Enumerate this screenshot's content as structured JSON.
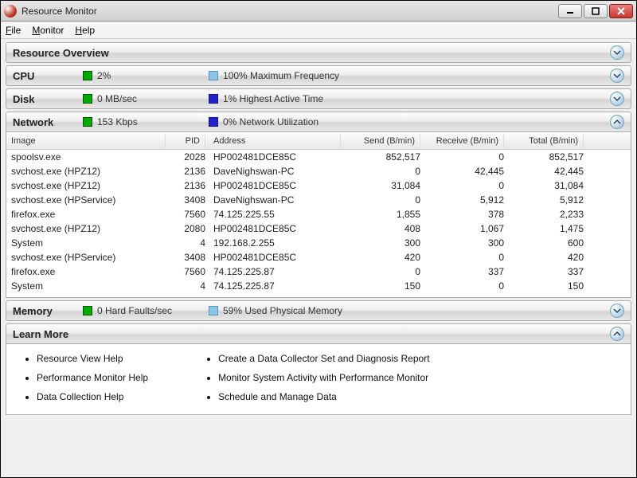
{
  "window": {
    "title": "Resource Monitor"
  },
  "menu": {
    "file": "File",
    "monitor": "Monitor",
    "help": "Help"
  },
  "panels": {
    "overview": {
      "label": "Resource Overview"
    },
    "cpu": {
      "label": "CPU",
      "metric1": "2%",
      "metric2": "100% Maximum Frequency"
    },
    "disk": {
      "label": "Disk",
      "metric1": "0 MB/sec",
      "metric2": "1% Highest Active Time"
    },
    "network": {
      "label": "Network",
      "metric1": "153 Kbps",
      "metric2": "0% Network Utilization"
    },
    "memory": {
      "label": "Memory",
      "metric1": "0 Hard Faults/sec",
      "metric2": "59% Used Physical Memory"
    },
    "learn": {
      "label": "Learn More"
    }
  },
  "network_table": {
    "headers": {
      "image": "Image",
      "pid": "PID",
      "address": "Address",
      "send": "Send (B/min)",
      "receive": "Receive (B/min)",
      "total": "Total (B/min)"
    },
    "rows": [
      {
        "image": "spoolsv.exe",
        "pid": "2028",
        "address": "HP002481DCE85C",
        "send": "852,517",
        "receive": "0",
        "total": "852,517"
      },
      {
        "image": "svchost.exe (HPZ12)",
        "pid": "2136",
        "address": "DaveNighswan-PC",
        "send": "0",
        "receive": "42,445",
        "total": "42,445"
      },
      {
        "image": "svchost.exe (HPZ12)",
        "pid": "2136",
        "address": "HP002481DCE85C",
        "send": "31,084",
        "receive": "0",
        "total": "31,084"
      },
      {
        "image": "svchost.exe (HPService)",
        "pid": "3408",
        "address": "DaveNighswan-PC",
        "send": "0",
        "receive": "5,912",
        "total": "5,912"
      },
      {
        "image": "firefox.exe",
        "pid": "7560",
        "address": "74.125.225.55",
        "send": "1,855",
        "receive": "378",
        "total": "2,233"
      },
      {
        "image": "svchost.exe (HPZ12)",
        "pid": "2080",
        "address": "HP002481DCE85C",
        "send": "408",
        "receive": "1,067",
        "total": "1,475"
      },
      {
        "image": "System",
        "pid": "4",
        "address": "192.168.2.255",
        "send": "300",
        "receive": "300",
        "total": "600"
      },
      {
        "image": "svchost.exe (HPService)",
        "pid": "3408",
        "address": "HP002481DCE85C",
        "send": "420",
        "receive": "0",
        "total": "420"
      },
      {
        "image": "firefox.exe",
        "pid": "7560",
        "address": "74.125.225.87",
        "send": "0",
        "receive": "337",
        "total": "337"
      },
      {
        "image": "System",
        "pid": "4",
        "address": "74.125.225.87",
        "send": "150",
        "receive": "0",
        "total": "150"
      }
    ]
  },
  "learn_more": {
    "col1": [
      "Resource View Help",
      "Performance Monitor Help",
      "Data Collection Help"
    ],
    "col2": [
      "Create a Data Collector Set and Diagnosis Report",
      "Monitor System Activity with Performance Monitor",
      "Schedule and Manage Data"
    ]
  }
}
